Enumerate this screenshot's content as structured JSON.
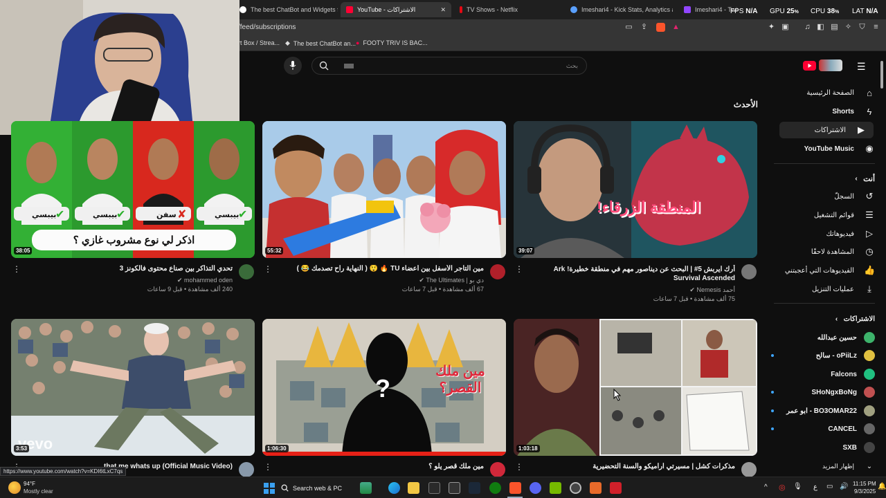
{
  "browser": {
    "tabs": [
      {
        "title": "The best ChatBot and Widgets for Ki",
        "active": false
      },
      {
        "title": "YouTube - الاشتراكات",
        "active": true
      },
      {
        "title": "TV Shows - Netflix",
        "active": false
      },
      {
        "title": "Imeshari4 - Kick Stats, Analytics and",
        "active": false
      },
      {
        "title": "Imeshari4 - Twitch",
        "active": false
      }
    ],
    "url": "/feed/subscriptions",
    "bookmarks": [
      "rt Box / Strea...",
      "The best ChatBot an...",
      "FOOTY TRIV IS BAC..."
    ]
  },
  "overlay_stats": {
    "fps_label": "FPS",
    "fps_value": "N/A",
    "gpu_label": "GPU",
    "gpu_value": "25",
    "cpu_label": "CPU",
    "cpu_value": "38",
    "lat_label": "LAT",
    "lat_value": "N/A"
  },
  "youtube": {
    "search_placeholder": "بحث",
    "section_heading": "الأحدث",
    "nav": [
      {
        "label": "الصفحة الرئيسية",
        "icon": "home-icon",
        "active": false
      },
      {
        "label": "Shorts",
        "icon": "shorts-icon",
        "active": false
      },
      {
        "label": "الاشتراكات",
        "icon": "subscriptions-icon",
        "active": true
      },
      {
        "label": "YouTube Music",
        "icon": "music-icon",
        "active": false
      }
    ],
    "you_heading": "أنت",
    "you_items": [
      {
        "label": "السجلّ",
        "icon": "history-icon"
      },
      {
        "label": "قوائم التشغيل",
        "icon": "playlist-icon"
      },
      {
        "label": "فيديوهاتك",
        "icon": "your-videos-icon"
      },
      {
        "label": "المشاهدة لاحقًا",
        "icon": "watch-later-icon"
      },
      {
        "label": "الفيديوهات التي أعجبتني",
        "icon": "like-icon"
      },
      {
        "label": "عمليات التنزيل",
        "icon": "download-icon"
      }
    ],
    "subs_heading": "الاشتراكات",
    "subscriptions": [
      {
        "name": "حسين عبدالله",
        "color": "#3db36b",
        "live": false
      },
      {
        "name": "سالح - oPiiLz",
        "color": "#e0c040",
        "live": true
      },
      {
        "name": "Falcons",
        "color": "#20c080",
        "live": false
      },
      {
        "name": "SHoNgxBoNg",
        "color": "#c05050",
        "live": true
      },
      {
        "name": "ابو عمر - BO3OMAR22",
        "color": "#a0a080",
        "live": true
      },
      {
        "name": "CANCEL",
        "color": "#666666",
        "live": false
      },
      {
        "name": "SXB",
        "color": "#444444",
        "live": false
      }
    ],
    "show_more": "إظهار المزيد",
    "videos": [
      {
        "title": "تحدي التذاكر بين صناع محتوى فالكونز 3",
        "channel": "mohammed oden",
        "meta": "240 ألف مشاهدة • قبل 9 ساعات",
        "duration": "38:05",
        "thumb_text": "اذكر لي نوع مشروب غازي ؟",
        "avatar_color": "#3a6b3a"
      },
      {
        "title": "مين التاجر الأسفل بين أعضاء TU 🔥 😲 ( النهاية راح تصدمك 😂 )",
        "channel": "دي بو | The Ultimates",
        "meta": "67 ألف مشاهدة • قبل 7 ساعات",
        "duration": "55:32",
        "thumb_text": "",
        "avatar_color": "#b0202a"
      },
      {
        "title": "أرك ايربش 5# | البحث عن ديناصور مهم في منطقة خطيرة! Ark Survival Ascended",
        "channel": "أحمد Nemesis",
        "meta": "75 ألف مشاهدة • قبل 7 ساعات",
        "duration": "39:07",
        "thumb_text": "المنطقة الزرقاء!",
        "avatar_color": "#777777"
      },
      {
        "title": "... that me whats up (Official Music Video)",
        "channel": "",
        "meta": "",
        "duration": "3:53",
        "thumb_text": "vevo",
        "avatar_color": "#8899aa"
      },
      {
        "title": "مين ملك قصر يلو ؟",
        "channel": "",
        "meta": "",
        "duration": "1:06:30",
        "thumb_text": "مين ملك القصر؟",
        "avatar_color": "#d0283a"
      },
      {
        "title": "مذكرات كشل | مسيرتي اراميكو والسنة التحضيرية",
        "channel": "",
        "meta": "",
        "duration": "1:03:18",
        "thumb_text": "",
        "avatar_color": "#999999"
      }
    ]
  },
  "status_url": "https://www.youtube.com/watch?v=KDI6tLxC7qs",
  "taskbar": {
    "weather_temp": "94°F",
    "weather_desc": "Mostly clear",
    "search_label": "Search web & PC",
    "time": "11:15 PM",
    "date": "9/3/2025",
    "lang": "ع"
  }
}
